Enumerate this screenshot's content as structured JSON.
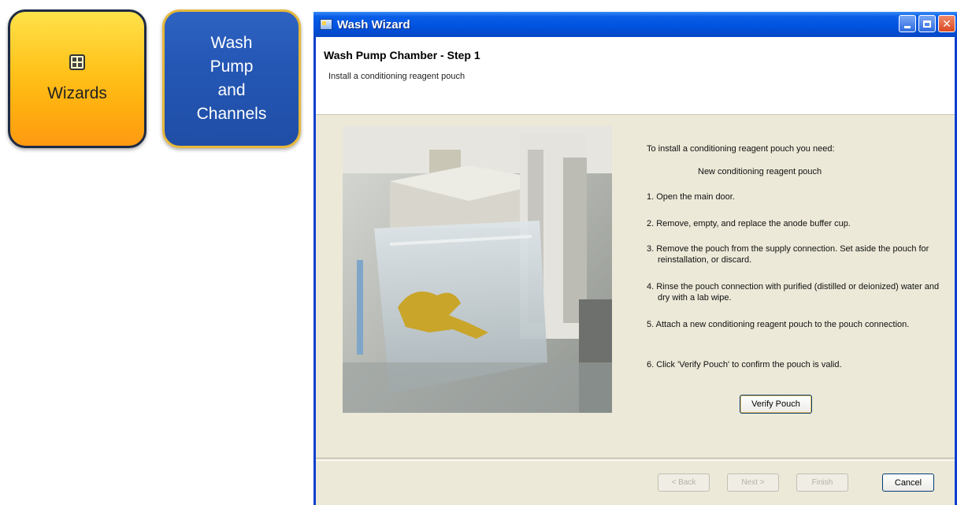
{
  "tiles": {
    "wizards": {
      "label": "Wizards",
      "icon": "grid-icon"
    },
    "wash": {
      "label": "Wash\nPump\nand\nChannels"
    }
  },
  "window": {
    "title": "Wash Wizard",
    "icon": "app-icon",
    "controls": {
      "minimize": "minimize-icon",
      "maximize": "maximize-icon",
      "close": "✕"
    }
  },
  "header": {
    "title": "Wash Pump Chamber - Step 1",
    "subtitle": "Install a conditioning reagent pouch"
  },
  "instructions": {
    "intro": "To install a conditioning reagent pouch you need:",
    "requirement": "New conditioning reagent pouch",
    "steps": [
      "1. Open the main door.",
      "2. Remove, empty, and replace the anode buffer cup.",
      "3. Remove the pouch from the supply connection. Set aside the pouch for reinstallation, or discard.",
      "4. Rinse the pouch connection with purified (distilled or deionized) water and dry with a lab wipe.",
      "5. Attach a new conditioning reagent pouch to the pouch connection.",
      "6. Click 'Verify Pouch' to confirm the pouch is valid."
    ]
  },
  "buttons": {
    "verify": "Verify Pouch",
    "back": "< Back",
    "next": "Next >",
    "finish": "Finish",
    "cancel": "Cancel"
  },
  "colors": {
    "titlebar": "#0052de",
    "window_bg": "#ece9d8",
    "wizards_tile": "#ffc21a",
    "wash_tile": "#2457b5"
  }
}
